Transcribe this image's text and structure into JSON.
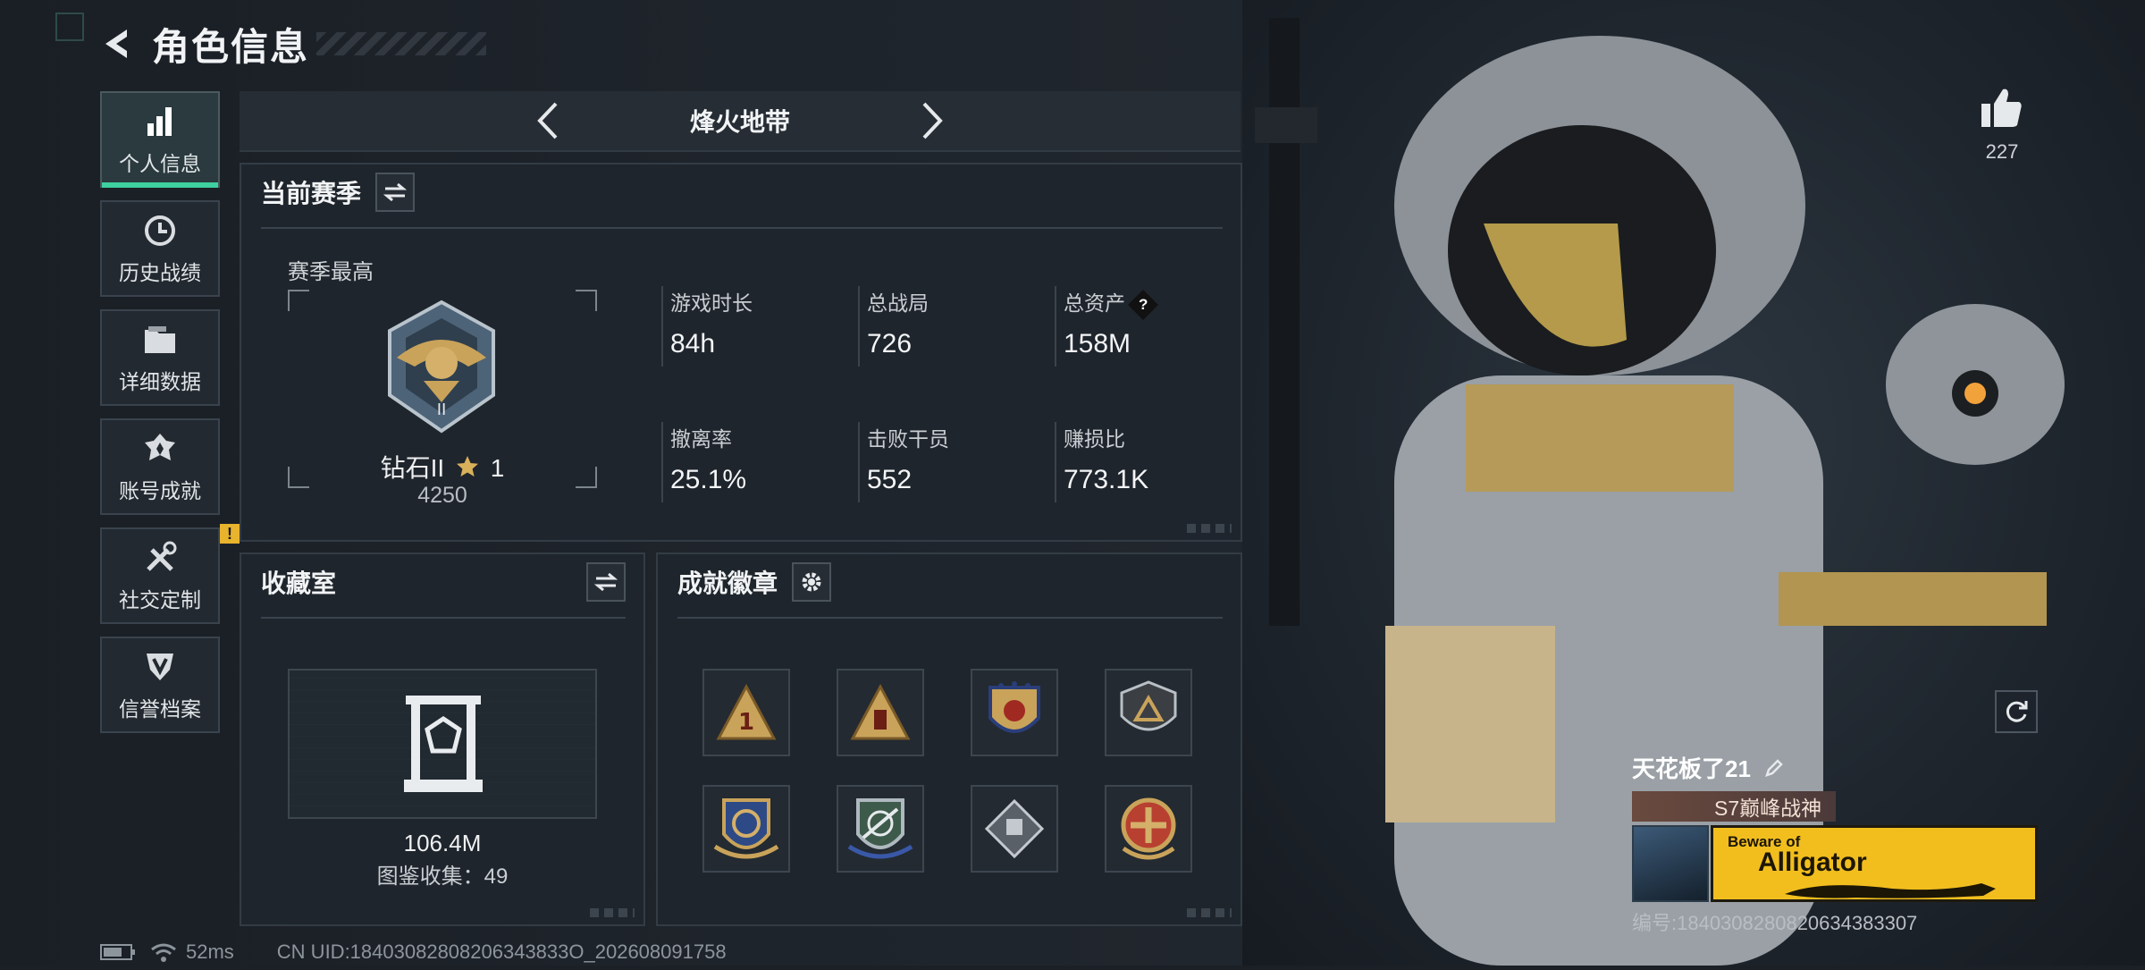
{
  "header": {
    "title": "角色信息"
  },
  "sidebar": {
    "items": [
      {
        "label": "个人信息",
        "icon": "bar-chart-icon",
        "active": true
      },
      {
        "label": "历史战绩",
        "icon": "history-clock-icon"
      },
      {
        "label": "详细数据",
        "icon": "folder-icon"
      },
      {
        "label": "账号成就",
        "icon": "achievement-icon"
      },
      {
        "label": "社交定制",
        "icon": "tools-icon",
        "badge": "!"
      },
      {
        "label": "信誉档案",
        "icon": "credit-shield-icon"
      }
    ]
  },
  "mode": {
    "name": "烽火地带"
  },
  "season": {
    "title": "当前赛季",
    "best_label": "赛季最高",
    "rank_name": "钻石II",
    "rank_stars": "1",
    "rank_score": "4250",
    "stats": [
      {
        "label": "游戏时长",
        "value": "84h"
      },
      {
        "label": "总战局",
        "value": "726"
      },
      {
        "label": "总资产",
        "value": "158M",
        "help": "?"
      },
      {
        "label": "撤离率",
        "value": "25.1%"
      },
      {
        "label": "击败干员",
        "value": "552"
      },
      {
        "label": "赚损比",
        "value": "773.1K"
      }
    ]
  },
  "collection": {
    "title": "收藏室",
    "value": "106.4M",
    "count_text": "图鉴收集：49"
  },
  "badges": {
    "title": "成就徽章"
  },
  "likes": {
    "count": "227"
  },
  "player": {
    "name": "天花板了21",
    "title": "S7巅峰战神",
    "banner_line1": "Beware of",
    "banner_line2": "Alligator",
    "id_text": "编号:1840308280820634383307"
  },
  "status": {
    "ping": "52ms",
    "uid": "CN UID:18403082808206343833O_202608091758"
  },
  "colors": {
    "accent": "#3fd0a0",
    "warning": "#e8b32d",
    "banner": "#f1be1e"
  }
}
